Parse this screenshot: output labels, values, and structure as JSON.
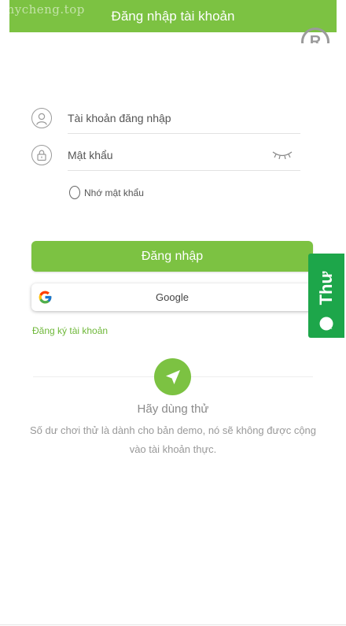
{
  "watermark": "mycheng.top",
  "header": {
    "title": "Đăng nhập tài khoản"
  },
  "form": {
    "username_placeholder": "Tài khoản đăng nhập",
    "password_placeholder": "Mật khẩu",
    "remember_label": "Nhớ mật khẩu"
  },
  "buttons": {
    "login_label": "Đăng nhập",
    "google_label": "Google",
    "register_label": "Đăng ký tài khoản"
  },
  "side_tab": {
    "label": "Thư"
  },
  "demo": {
    "title": "Hãy dùng thử",
    "description": "Số dư chơi thử là dành cho bản demo, nó sẽ không được cộng vào tài khoản thực."
  },
  "colors": {
    "accent": "#7cc242",
    "side_tab": "#1da64a",
    "link": "#6fb83a"
  },
  "icons": [
    "user-icon",
    "lock-icon",
    "eye-closed-icon",
    "google-icon",
    "chat-icon",
    "send-icon",
    "registered-icon"
  ]
}
